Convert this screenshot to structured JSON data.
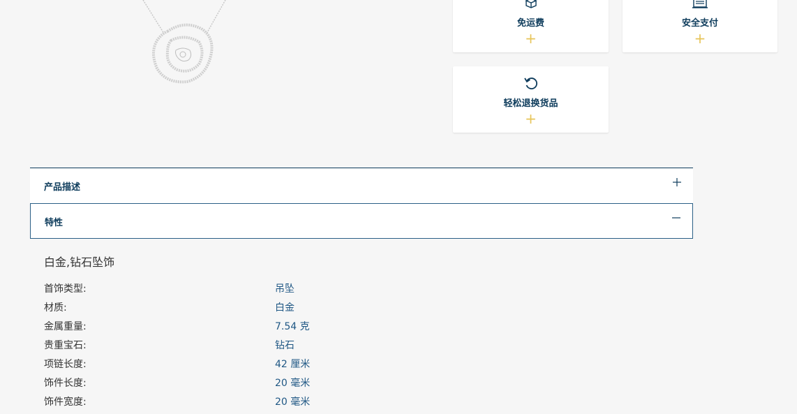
{
  "services": {
    "shipping": {
      "label": "免运费",
      "icon": "box-icon",
      "plus": "+"
    },
    "payment": {
      "label": "安全支付",
      "icon": "secure-payment-icon",
      "plus": "+"
    },
    "returns": {
      "label": "轻松退换货品",
      "icon": "refresh-icon",
      "plus": "+"
    }
  },
  "accordion": {
    "description": {
      "title": "产品描述",
      "toggle": "plus-icon",
      "expanded": false
    },
    "features": {
      "title": "特性",
      "toggle": "minus-icon",
      "expanded": true
    }
  },
  "features": {
    "title": "白金,钻石坠饰",
    "rows": [
      {
        "key": "首饰类型:",
        "value": "吊坠"
      },
      {
        "key": "材质:",
        "value": "白金"
      },
      {
        "key": "金属重量:",
        "value": "7.54 克"
      },
      {
        "key": "贵重宝石:",
        "value": "钻石"
      },
      {
        "key": "项链长度:",
        "value": "42 厘米"
      },
      {
        "key": "饰件长度:",
        "value": "20 毫米"
      },
      {
        "key": "饰件宽度:",
        "value": "20 毫米"
      }
    ]
  },
  "colors": {
    "text_primary": "#0d3b5b",
    "accent_plus": "#e7c458",
    "value_blue": "#1f5784",
    "background": "#f6f6f6"
  }
}
